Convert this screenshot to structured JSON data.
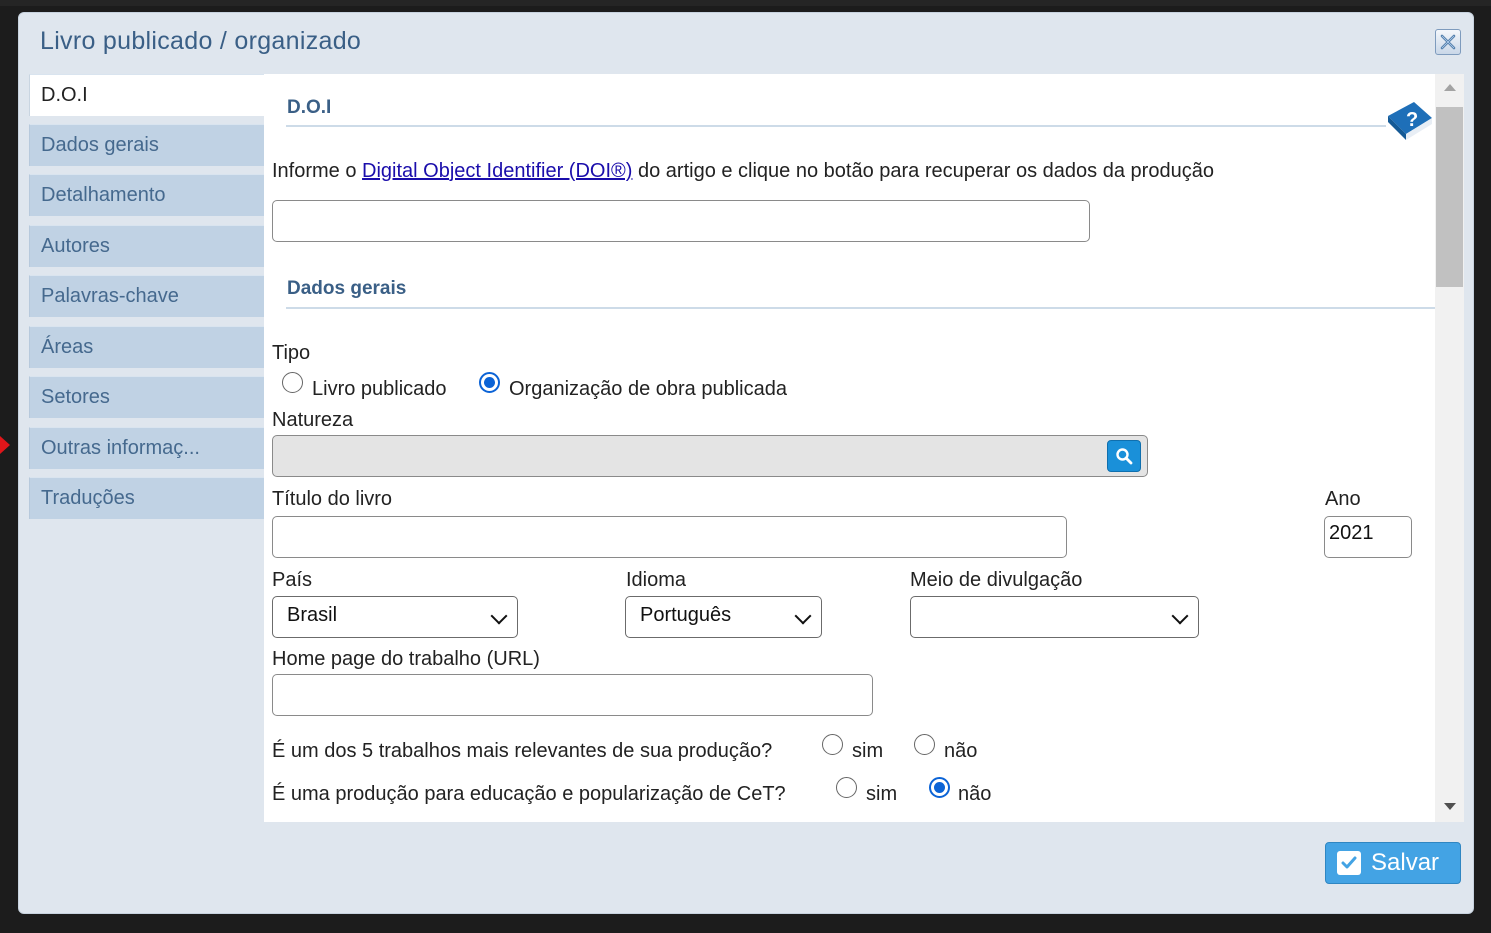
{
  "dialog": {
    "title": "Livro publicado / organizado"
  },
  "tabs": [
    {
      "label": "D.O.I"
    },
    {
      "label": "Dados gerais"
    },
    {
      "label": "Detalhamento"
    },
    {
      "label": "Autores"
    },
    {
      "label": "Palavras-chave"
    },
    {
      "label": "Áreas"
    },
    {
      "label": "Setores"
    },
    {
      "label": "Outras informaç..."
    },
    {
      "label": "Traduções"
    }
  ],
  "doi": {
    "section_title": "D.O.I",
    "text_before": "Informe o ",
    "link": "Digital Object Identifier (DOI®)",
    "text_after": " do artigo e clique no botão para recuperar os dados da produção",
    "value": ""
  },
  "general": {
    "section_title": "Dados gerais",
    "tipo_label": "Tipo",
    "tipo_options": [
      "Livro publicado",
      "Organização de obra publicada"
    ],
    "tipo_selected": "Organização de obra publicada",
    "natureza_label": "Natureza",
    "natureza_value": "",
    "titulo_label": "Título do livro",
    "titulo_value": "",
    "ano_label": "Ano",
    "ano_value": "2021",
    "pais_label": "País",
    "pais_value": "Brasil",
    "idioma_label": "Idioma",
    "idioma_value": "Português",
    "meio_label": "Meio de divulgação",
    "meio_value": "",
    "homepage_label": "Home page do trabalho (URL)",
    "homepage_value": "",
    "relevantes_question": "É um dos 5 trabalhos mais relevantes de sua produção?",
    "relevantes_selected": "none",
    "popularizacao_question": "É uma produção para educação e popularização de CeT?",
    "popularizacao_selected": "não",
    "yes_label": "sim",
    "no_label": "não"
  },
  "footer": {
    "save_label": "Salvar"
  },
  "colors": {
    "accent": "#3a5f86",
    "tab_bg": "#c0d2e4",
    "dialog_bg": "#dfe6ee",
    "save_bg": "#43a3e4",
    "radio_on": "#0b63d6"
  },
  "icons": {
    "close": "close-icon",
    "help": "help-book-icon",
    "search": "search-icon",
    "save": "check-icon"
  }
}
